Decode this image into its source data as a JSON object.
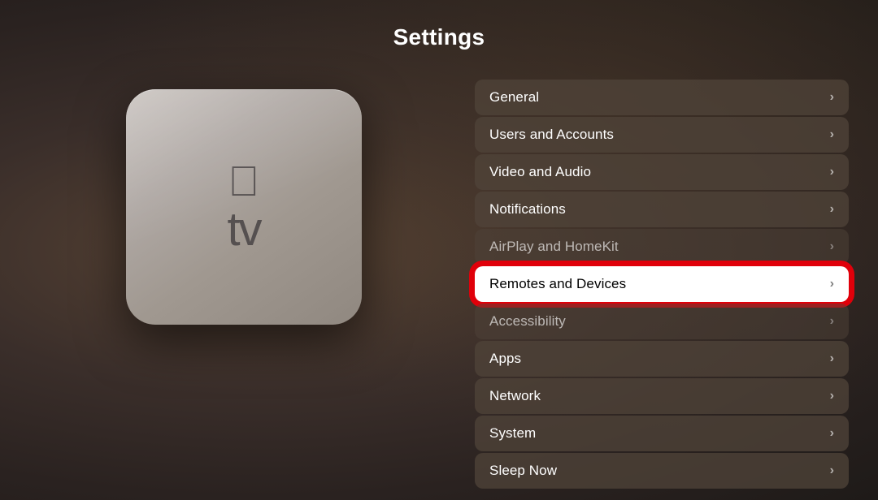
{
  "page": {
    "title": "Settings"
  },
  "apple_tv": {
    "logo": "",
    "tv_label": "tv"
  },
  "settings_items": [
    {
      "id": "general",
      "label": "General",
      "highlighted": false,
      "dimmed": false
    },
    {
      "id": "users-and-accounts",
      "label": "Users and Accounts",
      "highlighted": false,
      "dimmed": false
    },
    {
      "id": "video-and-audio",
      "label": "Video and Audio",
      "highlighted": false,
      "dimmed": false
    },
    {
      "id": "notifications",
      "label": "Notifications",
      "highlighted": false,
      "dimmed": false
    },
    {
      "id": "airplay-and-homekit",
      "label": "AirPlay and HomeKit",
      "highlighted": false,
      "dimmed": true
    },
    {
      "id": "remotes-and-devices",
      "label": "Remotes and Devices",
      "highlighted": true,
      "dimmed": false
    },
    {
      "id": "accessibility",
      "label": "Accessibility",
      "highlighted": false,
      "dimmed": true
    },
    {
      "id": "apps",
      "label": "Apps",
      "highlighted": false,
      "dimmed": false
    },
    {
      "id": "network",
      "label": "Network",
      "highlighted": false,
      "dimmed": false
    },
    {
      "id": "system",
      "label": "System",
      "highlighted": false,
      "dimmed": false
    },
    {
      "id": "sleep-now",
      "label": "Sleep Now",
      "highlighted": false,
      "dimmed": false
    }
  ]
}
